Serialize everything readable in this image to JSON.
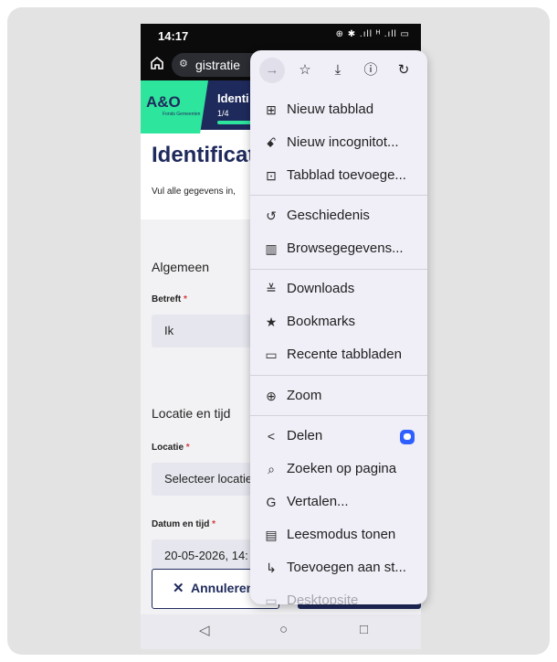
{
  "status_bar": {
    "time": "14:17",
    "icons": "⊕ ✱ .ıll ᴴ .ıll ▭"
  },
  "browser": {
    "url_text": "gistratie"
  },
  "app": {
    "logo_text": "A&O",
    "logo_sub": "Fonds Gemeenten",
    "header_title": "Identi",
    "step": "1/4",
    "progress_fraction": 0.25
  },
  "page": {
    "title": "Identificat",
    "intro": "Vul alle gegevens in,"
  },
  "form": {
    "section_general": "Algemeen",
    "betreft_label": "Betreft",
    "betreft_value": "Ik",
    "section_location": "Locatie en tijd",
    "location_label": "Locatie",
    "location_value": "Selecteer locatie",
    "datetime_label": "Datum en tijd",
    "datetime_value": "20-05-2026, 14:",
    "required_mark": "*",
    "cancel_label": "Annuleren",
    "cancel_icon": "✕"
  },
  "menu": {
    "icon_row": [
      "→",
      "☆",
      "⤓",
      "ⓘ",
      "↻"
    ],
    "items": [
      {
        "icon": "⊞",
        "label": "Nieuw tabblad"
      },
      {
        "icon": "ꗃ",
        "label": "Nieuw incognitot..."
      },
      {
        "icon": "⊡",
        "label": "Tabblad toevoege..."
      },
      {
        "icon": "↺",
        "label": "Geschiedenis"
      },
      {
        "icon": "▥",
        "label": "Browsegegevens..."
      },
      {
        "icon": "≚",
        "label": "Downloads"
      },
      {
        "icon": "★",
        "label": "Bookmarks"
      },
      {
        "icon": "▭",
        "label": "Recente tabbladen"
      },
      {
        "icon": "⊕",
        "label": "Zoom"
      },
      {
        "icon": "<",
        "label": "Delen"
      },
      {
        "icon": "⌕",
        "label": "Zoeken op pagina"
      },
      {
        "icon": "G",
        "label": "Vertalen..."
      },
      {
        "icon": "▤",
        "label": "Leesmodus tonen"
      },
      {
        "icon": "↳",
        "label": "Toevoegen aan st..."
      },
      {
        "icon": "▭",
        "label": "Desktopsite"
      }
    ]
  },
  "nav": {
    "back": "◁",
    "home": "○",
    "recents": "□"
  }
}
